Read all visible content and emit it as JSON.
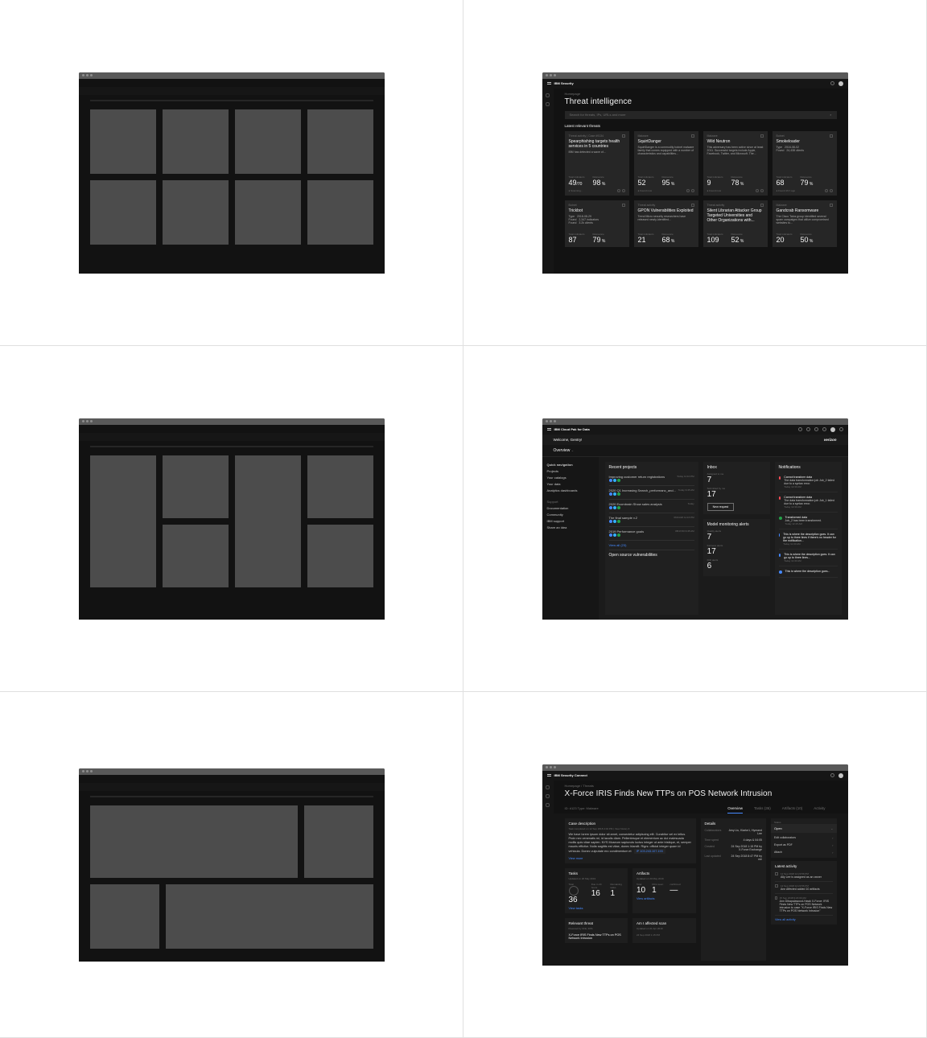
{
  "wire": {
    "placeholder": ""
  },
  "ti": {
    "brand": "IBM Security",
    "breadcrumb": "Homepage",
    "title": "Threat intelligence",
    "search_placeholder": "Search for threats, IPs, URLs and more",
    "section": "Latest relevant threats",
    "cards_row1": [
      {
        "tag": "Threat activity  |  Case #9134",
        "title": "Spearphishing targets health services in 5 countries",
        "desc": "IBM has detected a wave of...",
        "s1l": "Total indicators",
        "s1v": "49",
        "s1u": "/70",
        "s2l": "Relevance",
        "s2v": "98",
        "s2u": "%",
        "foot": "Scanning..."
      },
      {
        "tag": "Malware",
        "title": "SquirtDanger",
        "desc": "SquirtDanger is a commodity botnet malware family that comes equipped with a number of characteristics and capabilities...",
        "s1l": "Total indicators",
        "s1v": "52",
        "s1u": "",
        "s2l": "Relevance",
        "s2v": "95",
        "s2u": "%",
        "foot": "Found now"
      },
      {
        "tag": "Malware",
        "title": "Wild Neutron",
        "desc": "This adversary has been active since at least 2011. Successful targets include Apple, Facebook, Twitter, and Microsoft. The...",
        "s1l": "Total indicators",
        "s1v": "9",
        "s1u": "",
        "s2l": "Relevance",
        "s2v": "78",
        "s2u": "%",
        "foot": "Found now"
      },
      {
        "tag": "Botnet",
        "title": "Smokeloader",
        "desc1k": "Type",
        "desc1v": "2016-08-02",
        "desc2k": "Found",
        "desc2v": "24,438 clients",
        "s1l": "Total indicators",
        "s1v": "68",
        "s1u": "",
        "s2l": "Relevance",
        "s2v": "79",
        "s2u": "%",
        "foot": "Found 16 h ago"
      }
    ],
    "cards_row2": [
      {
        "tag": "Botnet",
        "title": "Trickbot",
        "desc1k": "Type",
        "desc1v": "2018-08-29",
        "desc2k": "Found",
        "desc2v": "2,347 indicators",
        "desc3k": "Found",
        "desc3v": "3.2k clients",
        "s1l": "Total indicators",
        "s1v": "87",
        "s2l": "Relevance",
        "s2v": "79",
        "s2u": "%"
      },
      {
        "tag": "Threat activity",
        "title": "GPON Vulnerabilities Exploited",
        "desc": "Trend Micro security researchers have released newly-identified...",
        "s1l": "Total indicators",
        "s1v": "21",
        "s2l": "Relevance",
        "s2v": "68",
        "s2u": "%"
      },
      {
        "tag": "Threat activity",
        "title": "Silent Librarian Attacker Group Targeted Universities and Other Organizations with...",
        "s1l": "Total indicators",
        "s1v": "109",
        "s2l": "Relevance",
        "s2v": "52",
        "s2u": "%"
      },
      {
        "tag": "Malware",
        "title": "Gandcrab Ransomware",
        "desc": "The Cisco Talos group identified several spam campaigns that utilize compromised websites to...",
        "s1l": "Total indicators",
        "s1v": "20",
        "s2l": "Relevance",
        "s2v": "50",
        "s2u": "%"
      }
    ]
  },
  "dash": {
    "brand": "IBM Cloud Pak for Data",
    "welcome": "Welcome, Gentry!",
    "partner": "verizon",
    "overview": "Overview",
    "nav_title": "Quick navigation",
    "nav": [
      "Projects",
      "Your catalogs",
      "Your data",
      "Analytics dashboards"
    ],
    "support_title": "Support",
    "support": [
      "Documentation",
      "Community",
      "IBM support",
      "Share an idea"
    ],
    "recent_title": "Recent projects",
    "projects": [
      {
        "name": "Improving customer return registrations",
        "time": "Today 11:10 PM"
      },
      {
        "name": "2020 Q1 Increasing Search_performanc_and...",
        "time": "Today 9:45 AM"
      },
      {
        "name": "2020 Ecombrain Show sales analysis",
        "time": "Today"
      },
      {
        "name": "The final sample v.2",
        "time": "06/21/20 11:16 PM"
      },
      {
        "name": "2019 Performance goals",
        "time": "08/17/20 9:45 AM"
      }
    ],
    "view_all": "View all (23)",
    "inbox_title": "Inbox",
    "inbox": [
      {
        "k": "Assigned to me",
        "v": "7"
      },
      {
        "k": "Submitted by me",
        "v": "17"
      }
    ],
    "new_request": "New request",
    "mon_title": "Model monitoring alerts",
    "mon": [
      {
        "k": "Quality alerts",
        "v": "7"
      },
      {
        "k": "Fairness alerts",
        "v": "17"
      },
      {
        "k": "Drift alerts",
        "v": "6"
      }
    ],
    "osv": "Open source vulnerabilities",
    "notif_title": "Notifications",
    "notifs": [
      {
        "c": "red",
        "t": "Cannot transform data",
        "d": "The data transformation job Job_2 failed due to a syntax error.",
        "w": "Today 12:30 AM"
      },
      {
        "c": "red",
        "t": "Cannot transform data",
        "d": "The data transformation job Job_1 failed due to a syntax error.",
        "w": "Today 12:30 AM"
      },
      {
        "c": "green",
        "t": "Transformed data",
        "d": "Job_2 has been transformed.",
        "w": "Today 12:15 AM"
      },
      {
        "c": "blue",
        "t": "This is where the description goes. It can go up to three lines if there's no header for the notification...",
        "d": "",
        "w": "Today 11:30 AM"
      },
      {
        "c": "blue",
        "t": "This is where the description goes. It can go up to three lines...",
        "d": "",
        "w": "Today 11:30 AM"
      },
      {
        "c": "blue",
        "t": "This is where the description goes...",
        "d": "",
        "w": ""
      }
    ]
  },
  "xf": {
    "brand": "IBM Security Connect",
    "breadcrumb": "Homepage  /  Threats",
    "title": "X-Force IRIS Finds New TTPs on POS Network Intrusion",
    "meta": "ID: #123     Type: Malware",
    "tabs": [
      "Overview",
      "Tasks (36)",
      "Artifacts (10)",
      "Activity"
    ],
    "case_title": "Case description",
    "case_sub": "Task completed on 12 Sep 2018 4:04 PM  |  View history  ▾",
    "case_body": "We have lorem ipsum dolor sit amet, consectetur adipiscing elit. Curabitur vel ex tellus. Proin nec venenatis mi, id iaculis diam. Pellentesque et elementum ac dui malesuada mollis quis vitae sapien. NYS Museum sapiunois luctus integer ut ante tristique, et, semper mauris efficitur. Nulla sagittis est vitae, donec blandit. Rigrs: official integer quam id vehicula. Donec vulputate ero condimentum et  ",
    "ip_label": "IP",
    "ip": "103.243.107.193",
    "view_more": "View more",
    "details_title": "Details",
    "details": [
      {
        "k": "Collaborators",
        "v": "Amy Liu, Klarke1, Hymand Lee"
      },
      {
        "k": "Time spent",
        "v": "4 days & 04:05"
      },
      {
        "k": "Created",
        "v": "24 Sep 2018 1:15 PM by X-Force Exchange"
      },
      {
        "k": "Last updated",
        "v": "24 Sep 2018 8:47 PM by me"
      }
    ],
    "status_label": "Status",
    "status": "Open",
    "actions": [
      "Edit collaborators",
      "Export as PDF",
      "Attach"
    ],
    "activity_title": "Latest activity",
    "activity": [
      {
        "w": "12 Sep 2018 12:23:56 PM",
        "t": "Ally Lee is assigned as an owner"
      },
      {
        "w": "12 Sep 2018 12:23:56 PM",
        "t": "Ann Affected added 10 artifacts"
      },
      {
        "w": "15 Sep 2018 9:23:09 AM",
        "t": "Ann Dibapalawood-Hawk X-Force: IRIS Finds New TTPs on POS Network Intrusion to case \"X-Force IRIS Finds New TTPs on POS Network Intrusion\""
      }
    ],
    "view_activity": "View all activity",
    "tasks_title": "Tasks",
    "tasks_sub": "Updated on 20 May 2019",
    "tasks": [
      {
        "k": "Total",
        "v": "36",
        "ring": true
      },
      {
        "k": "Due in 24 hours",
        "v": "16"
      },
      {
        "k": "Remaining tasks",
        "v": "1"
      }
    ],
    "view_tasks": "View tasks",
    "arts_title": "Artifacts",
    "arts_sub": "Updated on 20 May 2019",
    "arts": [
      {
        "k": "Total",
        "v": "10"
      },
      {
        "k": "IOCs seen",
        "v": "1"
      },
      {
        "k": "confirmed",
        "v": "—"
      }
    ],
    "view_arts": "View artifacts",
    "threat_title": "Relevant threat",
    "threat_sub": "Powered by XFE, IRIS",
    "threat_name": "X-Force IRIS Finds New TTPs on POS Network Intrusion",
    "affected_title": "Am I affected scan",
    "affected_sub": "Updated on 21 Apr 2019",
    "affected_when": "24 Sep 2018 1:15 PM"
  }
}
